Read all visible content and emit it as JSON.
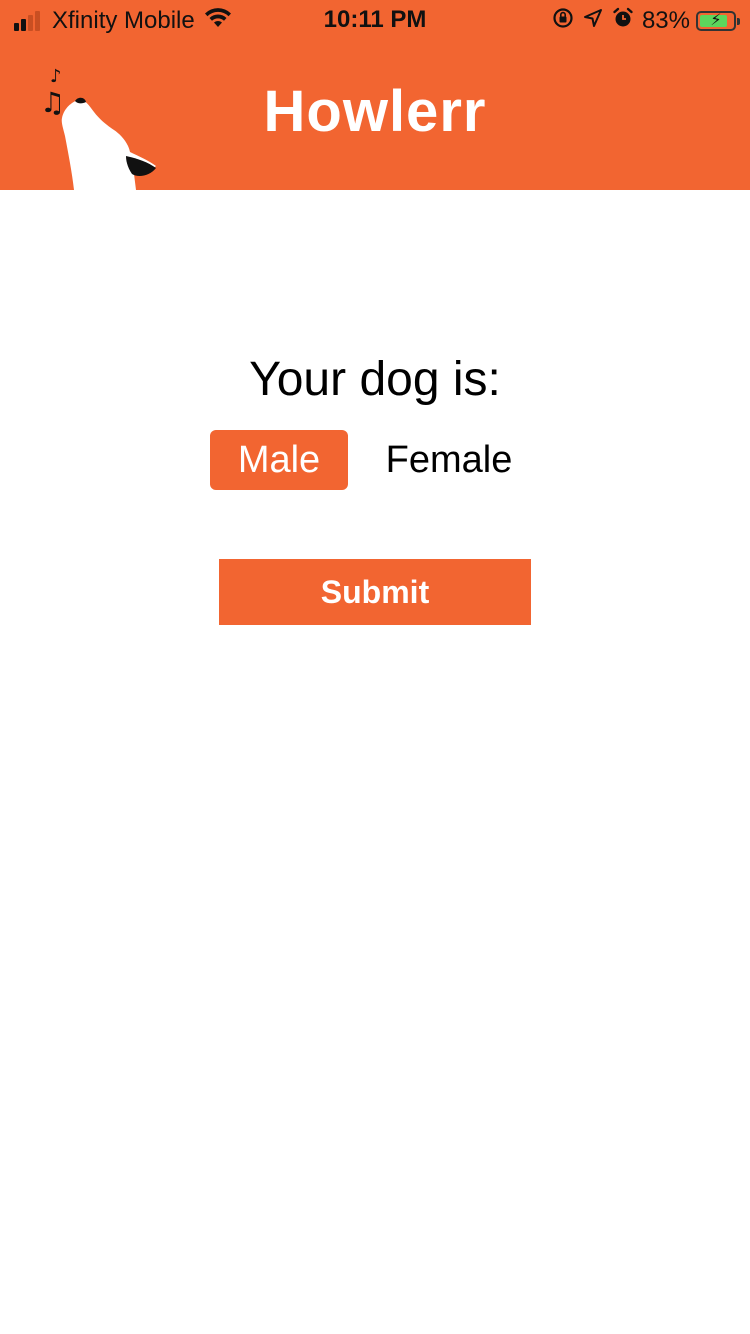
{
  "status_bar": {
    "carrier": "Xfinity Mobile",
    "time": "10:11 PM",
    "battery_percent_text": "83%",
    "battery_level": 0.83,
    "icons": [
      "signal-icon",
      "wifi-icon",
      "orientation-lock-icon",
      "location-arrow-icon",
      "alarm-icon",
      "battery-icon"
    ]
  },
  "header": {
    "title": "Howlerr",
    "logo": "howling-dog-icon",
    "background_color": "#F26531"
  },
  "form": {
    "prompt": "Your dog is:",
    "options": [
      {
        "label": "Male",
        "selected": true
      },
      {
        "label": "Female",
        "selected": false
      }
    ],
    "submit_label": "Submit"
  },
  "colors": {
    "accent": "#F26531",
    "text": "#000000",
    "background": "#FFFFFF"
  }
}
